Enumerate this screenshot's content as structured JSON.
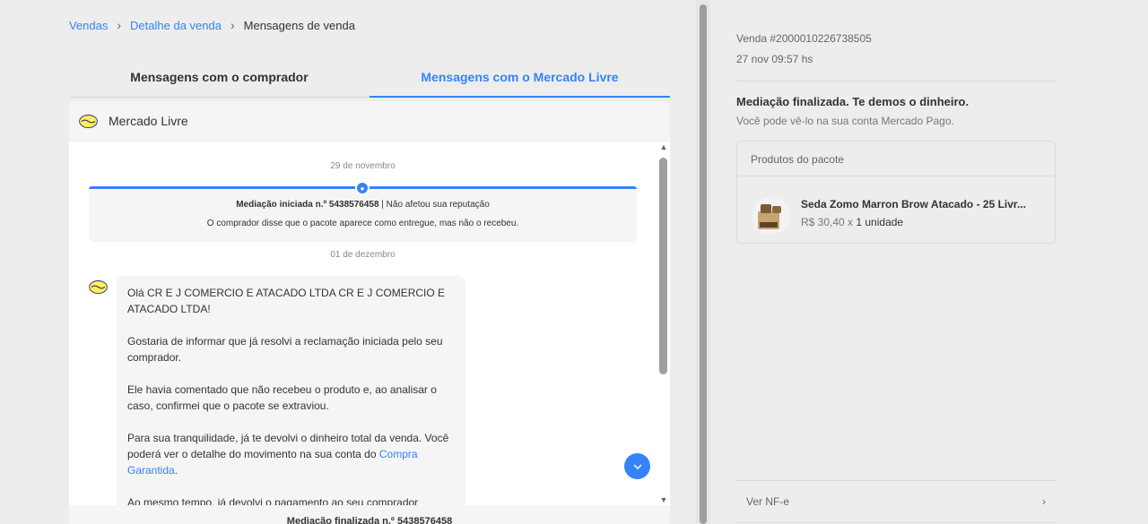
{
  "breadcrumb": {
    "items": [
      "Vendas",
      "Detalhe da venda"
    ],
    "current": "Mensagens de venda",
    "separator": "›"
  },
  "tabs": [
    {
      "label": "Mensagens com o comprador",
      "active": false
    },
    {
      "label": "Mensagens com o Mercado Livre",
      "active": true
    }
  ],
  "conversation": {
    "title": "Mercado Livre",
    "date1": "29 de novembro",
    "mediation": {
      "line1_bold": "Mediação iniciada n.º 5438576458",
      "line1_rest": " | Não afetou sua reputação",
      "line2": "O comprador disse que o pacote aparece como entregue, mas não o recebeu."
    },
    "date2": "01 de dezembro",
    "message": {
      "p1": "Olá CR E J COMERCIO E ATACADO LTDA CR E J COMERCIO E ATACADO LTDA!",
      "p2": "Gostaria de informar que já resolvi a reclamação iniciada pelo seu comprador.",
      "p3": "Ele havia comentado que não recebeu o produto e, ao analisar o caso, confirmei que o pacote se extraviou.",
      "p4": "Para sua tranquilidade, já te devolvi o dinheiro total da venda. Você poderá ver o detalhe do movimento na sua conta do",
      "p4_link": "Compra Garantida",
      "p4_end": ".",
      "p5": "Ao mesmo tempo, já devolvi o pagamento ao seu comprador"
    },
    "footer": "Mediação finalizada n.º 5438576458"
  },
  "sale": {
    "id": "Venda #2000010226738505",
    "time": "27 nov 09:57 hs",
    "status_title": "Mediação finalizada. Te demos o dinheiro.",
    "status_sub": "Você pode vê-lo na sua conta Mercado Pago.",
    "products_header": "Produtos do pacote",
    "product_name": "Seda Zomo Marron Brow Atacado - 25 Livr...",
    "price_prefix": "R$ 30,40 x ",
    "price_qty": "1 unidade",
    "nfe_label": "Ver NF-e",
    "nfe_chevron": "›"
  },
  "colors": {
    "accent": "#3483fa",
    "background": "#ededed"
  },
  "icons": {
    "logo": "mercado-livre-handshake-icon",
    "scroll_down": "chevron-down-icon"
  }
}
